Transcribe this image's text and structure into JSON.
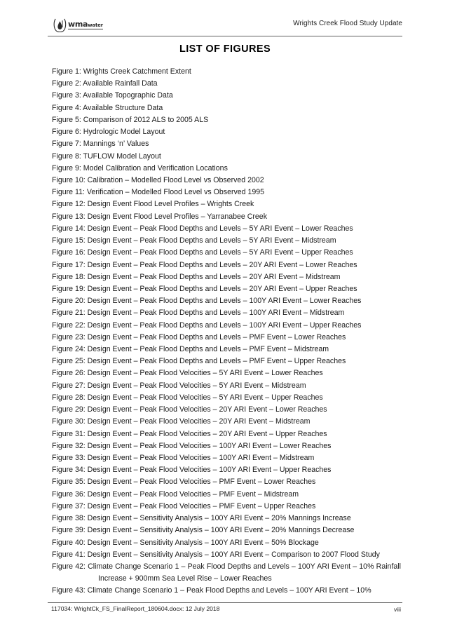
{
  "header": {
    "logo_mark": "water-droplet-icon",
    "logo_text_primary": "wma",
    "logo_text_secondary": "water",
    "document_title": "Wrights Creek Flood Study Update"
  },
  "page": {
    "title": "LIST OF FIGURES"
  },
  "figures": [
    {
      "text": "Figure 1: Wrights Creek Catchment Extent",
      "wrapped": false
    },
    {
      "text": "Figure 2: Available Rainfall Data",
      "wrapped": false
    },
    {
      "text": "Figure 3: Available Topographic Data",
      "wrapped": false
    },
    {
      "text": "Figure 4: Available Structure Data",
      "wrapped": false
    },
    {
      "text": "Figure 5: Comparison of 2012 ALS to 2005 ALS",
      "wrapped": false
    },
    {
      "text": "Figure 6: Hydrologic Model Layout",
      "wrapped": false
    },
    {
      "text": "Figure 7: Mannings ‘n’ Values",
      "wrapped": false
    },
    {
      "text": "Figure 8: TUFLOW Model Layout",
      "wrapped": false
    },
    {
      "text": "Figure 9: Model Calibration and Verification Locations",
      "wrapped": false
    },
    {
      "text": "Figure 10: Calibration – Modelled Flood Level vs Observed 2002",
      "wrapped": false
    },
    {
      "text": "Figure 11: Verification – Modelled Flood Level vs Observed 1995",
      "wrapped": false
    },
    {
      "text": "Figure 12: Design Event Flood Level Profiles – Wrights Creek",
      "wrapped": false
    },
    {
      "text": "Figure 13: Design Event Flood Level Profiles – Yarranabee Creek",
      "wrapped": false
    },
    {
      "text": "Figure 14: Design Event – Peak Flood Depths and Levels – 5Y ARI Event – Lower Reaches",
      "wrapped": false
    },
    {
      "text": "Figure 15: Design Event – Peak Flood Depths and Levels – 5Y ARI Event – Midstream",
      "wrapped": false
    },
    {
      "text": "Figure 16: Design Event – Peak Flood Depths and Levels – 5Y ARI Event – Upper Reaches",
      "wrapped": false
    },
    {
      "text": "Figure 17: Design Event – Peak Flood Depths and Levels – 20Y ARI Event – Lower Reaches",
      "wrapped": false
    },
    {
      "text": "Figure 18: Design Event – Peak Flood Depths and Levels – 20Y ARI Event – Midstream",
      "wrapped": false
    },
    {
      "text": "Figure 19: Design Event – Peak Flood Depths and Levels – 20Y ARI Event – Upper Reaches",
      "wrapped": false
    },
    {
      "text": "Figure 20: Design Event – Peak Flood Depths and Levels – 100Y ARI Event – Lower Reaches",
      "wrapped": false
    },
    {
      "text": "Figure 21: Design Event – Peak Flood Depths and Levels – 100Y ARI Event – Midstream",
      "wrapped": false
    },
    {
      "text": "Figure 22: Design Event – Peak Flood Depths and Levels – 100Y ARI Event – Upper Reaches",
      "wrapped": false
    },
    {
      "text": "Figure 23: Design Event – Peak Flood Depths and Levels – PMF Event – Lower Reaches",
      "wrapped": false
    },
    {
      "text": "Figure 24: Design Event – Peak Flood Depths and Levels – PMF Event – Midstream",
      "wrapped": false
    },
    {
      "text": "Figure 25: Design Event – Peak Flood Depths and Levels – PMF Event – Upper Reaches",
      "wrapped": false
    },
    {
      "text": "Figure 26: Design Event – Peak Flood Velocities – 5Y ARI Event – Lower Reaches",
      "wrapped": false
    },
    {
      "text": "Figure 27: Design Event – Peak Flood Velocities – 5Y ARI Event – Midstream",
      "wrapped": false
    },
    {
      "text": "Figure 28: Design Event – Peak Flood Velocities – 5Y ARI Event – Upper Reaches",
      "wrapped": false
    },
    {
      "text": "Figure 29: Design Event – Peak Flood Velocities – 20Y ARI Event – Lower Reaches",
      "wrapped": false
    },
    {
      "text": "Figure 30: Design Event – Peak Flood Velocities – 20Y ARI Event – Midstream",
      "wrapped": false
    },
    {
      "text": "Figure 31: Design Event – Peak Flood Velocities – 20Y ARI Event – Upper Reaches",
      "wrapped": false
    },
    {
      "text": "Figure 32: Design Event – Peak Flood Velocities – 100Y ARI Event – Lower Reaches",
      "wrapped": false
    },
    {
      "text": "Figure 33: Design Event – Peak Flood Velocities – 100Y ARI Event – Midstream",
      "wrapped": false
    },
    {
      "text": "Figure 34: Design Event – Peak Flood Velocities – 100Y ARI Event – Upper Reaches",
      "wrapped": false
    },
    {
      "text": "Figure 35: Design Event – Peak Flood Velocities – PMF Event – Lower Reaches",
      "wrapped": false
    },
    {
      "text": "Figure 36: Design Event – Peak Flood Velocities – PMF Event – Midstream",
      "wrapped": false
    },
    {
      "text": "Figure 37: Design Event – Peak Flood Velocities – PMF Event – Upper Reaches",
      "wrapped": false
    },
    {
      "text": "Figure 38: Design Event – Sensitivity Analysis – 100Y ARI Event – 20% Mannings Increase",
      "wrapped": false
    },
    {
      "text": "Figure 39: Design Event – Sensitivity Analysis – 100Y ARI Event – 20% Mannings Decrease",
      "wrapped": false
    },
    {
      "text": "Figure 40: Design Event – Sensitivity Analysis – 100Y ARI Event – 50% Blockage",
      "wrapped": false
    },
    {
      "text": "Figure 41: Design Event – Sensitivity Analysis – 100Y ARI Event – Comparison to 2007 Flood Study",
      "wrapped": true
    },
    {
      "text": "Figure 42: Climate Change Scenario 1 – Peak Flood Depths and Levels – 100Y ARI Event – 10% Rainfall Increase + 900mm Sea Level Rise – Lower Reaches",
      "wrapped": true
    },
    {
      "text": "Figure 43: Climate Change Scenario 1 – Peak Flood Depths and Levels – 100Y ARI Event – 10%",
      "wrapped": false
    }
  ],
  "footer": {
    "document_reference": "117034: WrightCk_FS_FinalReport_180604.docx: 12 July 2018",
    "page_number": "viii"
  },
  "colors": {
    "text": "#1a1a1a",
    "rule": "#5e5e5e",
    "page_background": "#ffffff"
  }
}
